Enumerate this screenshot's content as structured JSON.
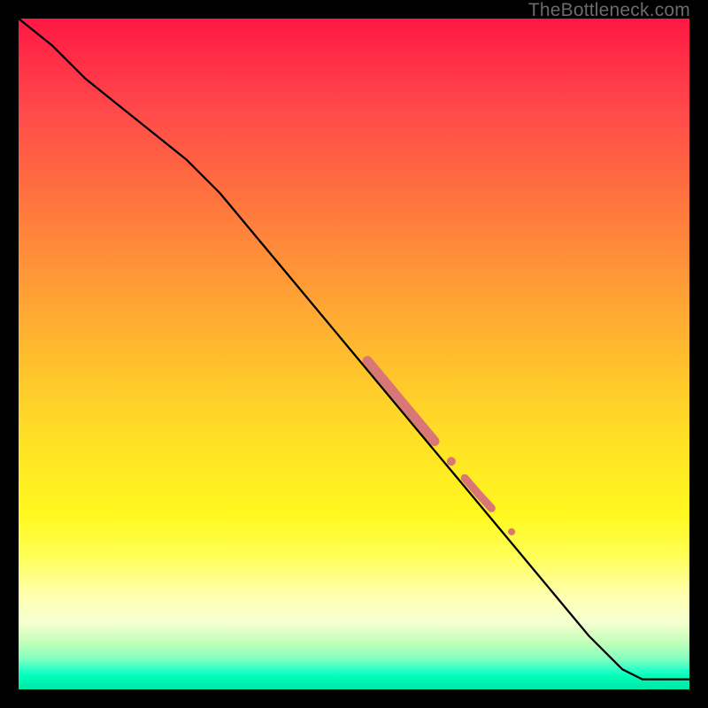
{
  "watermark": "TheBottleneck.com",
  "gradient_colors": {
    "top": "#ff1744",
    "mid": "#ffe324",
    "bottom": "#00e6a6"
  },
  "chart_data": {
    "type": "line",
    "title": "",
    "xlabel": "",
    "ylabel": "",
    "xlim": [
      0,
      100
    ],
    "ylim": [
      0,
      100
    ],
    "series": [
      {
        "name": "curve",
        "color": "#000000",
        "x": [
          0,
          5,
          10,
          15,
          20,
          25,
          30,
          35,
          40,
          45,
          50,
          55,
          60,
          65,
          70,
          75,
          80,
          85,
          90,
          93,
          100
        ],
        "y": [
          100,
          96,
          91,
          87,
          83,
          79,
          74,
          68,
          62,
          56,
          50,
          44,
          38,
          32,
          26,
          20,
          14,
          8,
          3,
          1.5,
          1.5
        ]
      }
    ],
    "highlights": [
      {
        "name": "thick-segment-1",
        "color": "#d97676",
        "width": 11,
        "x": [
          52,
          54.5,
          57,
          59.5,
          62
        ],
        "y": [
          49,
          46,
          43,
          40,
          37
        ]
      },
      {
        "name": "dot-1",
        "color": "#d97676",
        "r": 5,
        "x": [
          64.5
        ],
        "y": [
          34
        ]
      },
      {
        "name": "thick-segment-2",
        "color": "#d97676",
        "width": 9,
        "x": [
          66.5,
          68.5,
          70.5
        ],
        "y": [
          31.5,
          29.2,
          27
        ]
      },
      {
        "name": "dot-2",
        "color": "#d97676",
        "r": 4,
        "x": [
          73.5
        ],
        "y": [
          23.5
        ]
      }
    ]
  }
}
